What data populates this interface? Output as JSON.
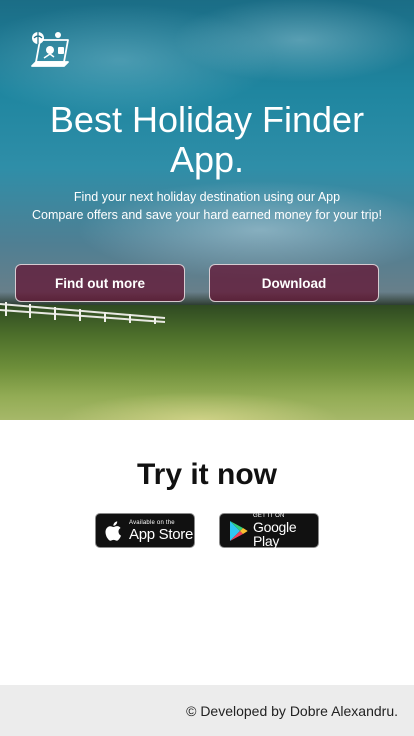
{
  "hero": {
    "logo_icon": "laptop-travel-icon",
    "title": "Best Holiday Finder App.",
    "subtitle_line1": "Find your next holiday destination using our App",
    "subtitle_line2": "Compare offers and save your hard earned money for your trip!",
    "buttons": {
      "find_out_more": "Find out more",
      "download": "Download"
    },
    "button_color": "#641030"
  },
  "try_section": {
    "title": "Try it now",
    "app_store": {
      "small": "Available on the",
      "big": "App Store",
      "icon": "apple-icon"
    },
    "google_play": {
      "small": "GET IT ON",
      "big": "Google Play",
      "icon": "google-play-icon"
    }
  },
  "footer": {
    "text": "© Developed by Dobre Alexandru."
  }
}
